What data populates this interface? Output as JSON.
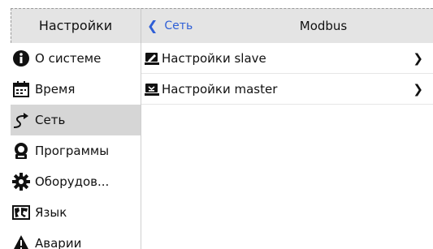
{
  "header": {
    "section_title": "Настройки",
    "back_label": "Сеть",
    "page_title": "Modbus"
  },
  "sidebar": {
    "items": [
      {
        "label": "О системе",
        "icon": "info-icon"
      },
      {
        "label": "Время",
        "icon": "calendar-icon"
      },
      {
        "label": "Сеть",
        "icon": "network-path-icon",
        "active": true
      },
      {
        "label": "Программы",
        "icon": "program-icon"
      },
      {
        "label": "Оборудов...",
        "icon": "gear-icon"
      },
      {
        "label": "Язык",
        "icon": "map-icon"
      },
      {
        "label": "Аварии",
        "icon": "warning-icon"
      }
    ]
  },
  "main": {
    "rows": [
      {
        "label": "Настройки slave",
        "icon": "edit-device-icon"
      },
      {
        "label": "Настройки master",
        "icon": "master-device-icon"
      }
    ]
  },
  "colors": {
    "header_bg": "#e4e4e4",
    "accent": "#2f5fd6",
    "active_bg": "#d6d6d6"
  }
}
